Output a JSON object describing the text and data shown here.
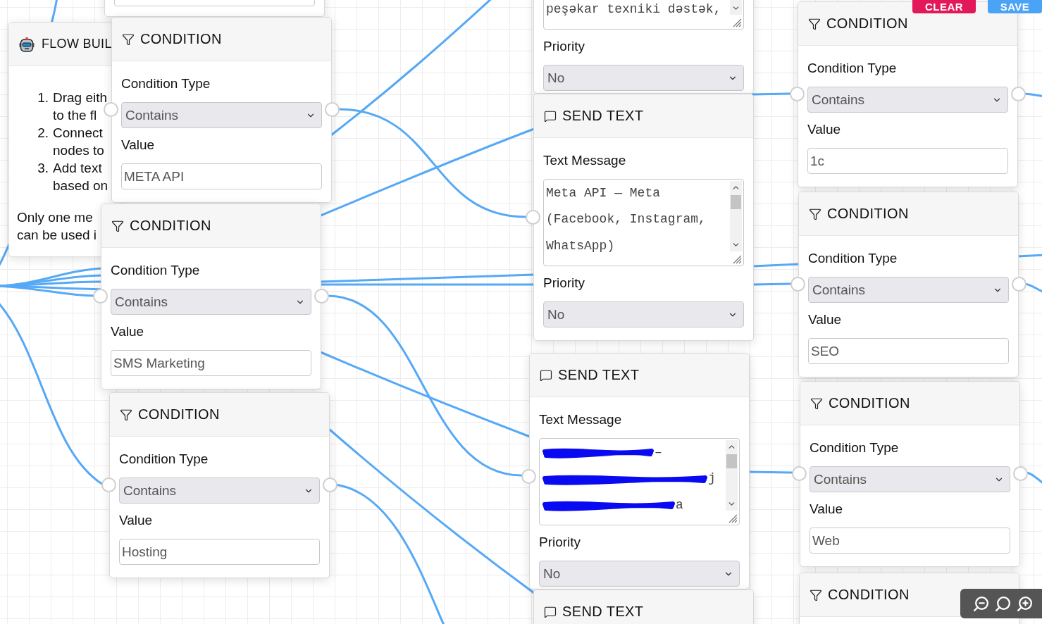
{
  "info_panel": {
    "title": "FLOW BUIL",
    "steps": [
      {
        "number": "1.",
        "lines": [
          "Drag eith",
          "to the fl"
        ]
      },
      {
        "number": "2.",
        "lines": [
          "Connect",
          "nodes to"
        ]
      },
      {
        "number": "3.",
        "lines": [
          "Add text",
          "based on"
        ]
      }
    ],
    "note_lines": [
      "Only one me",
      "can be used i"
    ]
  },
  "nodes": [
    {
      "fields": [
        {
          "kind": "input"
        }
      ]
    },
    {
      "kind": "condition",
      "title": "CONDITION",
      "fields": [
        {
          "kind": "select",
          "label": "Condition Type",
          "value": "Contains"
        },
        {
          "kind": "input",
          "label": "Value",
          "value": "META API"
        }
      ]
    },
    {
      "kind": "condition",
      "title": "CONDITION",
      "fields": [
        {
          "kind": "select",
          "label": "Condition Type",
          "value": "Contains"
        },
        {
          "kind": "input",
          "label": "Value",
          "value": "SMS Marketing"
        }
      ]
    },
    {
      "kind": "condition",
      "title": "CONDITION",
      "fields": [
        {
          "kind": "select",
          "label": "Condition Type",
          "value": "Contains"
        },
        {
          "kind": "input",
          "label": "Value",
          "value": "Hosting"
        }
      ]
    },
    {
      "fields": [
        {
          "kind": "textarea",
          "lines": [
            {
              "text": "peşəkar texniki dəstək,",
              "redacted": false
            }
          ]
        },
        {
          "kind": "select",
          "label": "Priority",
          "value": "No"
        }
      ]
    },
    {
      "kind": "send_text",
      "title": "SEND TEXT",
      "fields": [
        {
          "kind": "textarea",
          "label": "Text Message",
          "lines": [
            {
              "text": "Meta API — Meta",
              "redacted": false
            },
            {
              "text": "(Facebook, Instagram,",
              "redacted": false
            },
            {
              "text": "WhatsApp)",
              "redacted": false
            }
          ]
        },
        {
          "kind": "select",
          "label": "Priority",
          "value": "No"
        }
      ]
    },
    {
      "kind": "send_text",
      "title": "SEND TEXT",
      "fields": [
        {
          "kind": "textarea",
          "label": "Text Message",
          "lines": [
            {
              "text": "–",
              "redacted": true
            },
            {
              "text": "j",
              "redacted": true
            },
            {
              "text": "a",
              "redacted": true
            }
          ]
        },
        {
          "kind": "select",
          "label": "Priority",
          "value": "No"
        }
      ]
    },
    {
      "kind": "send_text",
      "title": "SEND TEXT"
    },
    {
      "kind": "condition",
      "title": "CONDITION",
      "fields": [
        {
          "kind": "select",
          "label": "Condition Type",
          "value": "Contains"
        },
        {
          "kind": "input",
          "label": "Value",
          "value": "1c"
        }
      ]
    },
    {
      "kind": "condition",
      "title": "CONDITION",
      "fields": [
        {
          "kind": "select",
          "label": "Condition Type",
          "value": "Contains"
        },
        {
          "kind": "input",
          "label": "Value",
          "value": "SEO"
        }
      ]
    },
    {
      "kind": "condition",
      "title": "CONDITION",
      "fields": [
        {
          "kind": "select",
          "label": "Condition Type",
          "value": "Contains"
        },
        {
          "kind": "input",
          "label": "Value",
          "value": "Web"
        }
      ]
    },
    {
      "kind": "condition",
      "title": "CONDITION"
    }
  ],
  "toolbar": {
    "buttons": [
      {
        "label": "CLEAR",
        "kind": "danger"
      },
      {
        "label": "SAVE",
        "kind": "primary"
      }
    ]
  }
}
